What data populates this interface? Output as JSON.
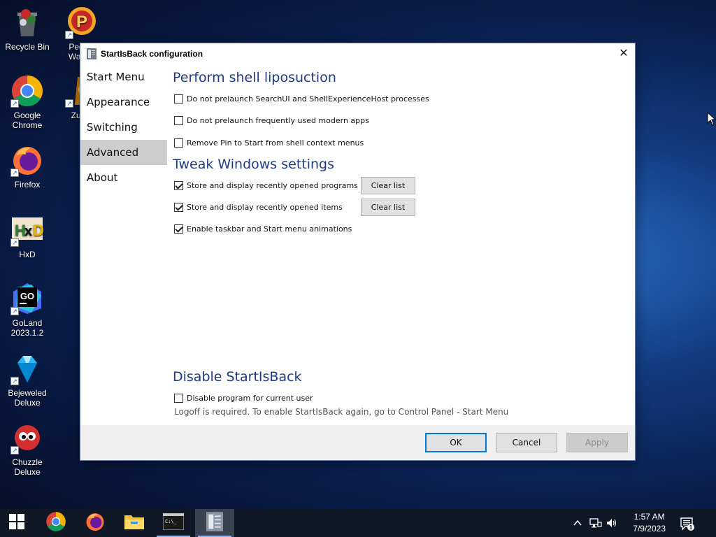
{
  "desktop": {
    "icons": [
      {
        "label": "Recycle Bin",
        "icon": "recycle-bin-icon"
      },
      {
        "label": "Peggle",
        "label2": "Warcra",
        "icon": "peggle-icon"
      },
      {
        "label": "Google Chrome",
        "icon": "chrome-icon"
      },
      {
        "label": "Zuma",
        "icon": "zuma-icon"
      },
      {
        "label": "Firefox",
        "icon": "firefox-icon"
      },
      {
        "label": "HxD",
        "icon": "hxd-icon"
      },
      {
        "label": "GoLand",
        "label2": "2023.1.2",
        "icon": "goland-icon"
      },
      {
        "label": "Bejeweled",
        "label2": "Deluxe",
        "icon": "bejeweled-icon"
      },
      {
        "label": "Chuzzle Deluxe",
        "icon": "chuzzle-icon"
      }
    ]
  },
  "dialog": {
    "title": "StartIsBack configuration",
    "close_glyph": "✕",
    "nav": [
      {
        "label": "Start Menu"
      },
      {
        "label": "Appearance"
      },
      {
        "label": "Switching"
      },
      {
        "label": "Advanced",
        "selected": true
      },
      {
        "label": "About"
      }
    ],
    "sections": {
      "liposuction": {
        "heading": "Perform shell liposuction",
        "options": [
          {
            "label": "Do not prelaunch SearchUI and ShellExperienceHost processes",
            "checked": false
          },
          {
            "label": "Do not prelaunch frequently used modern apps",
            "checked": false
          },
          {
            "label": "Remove Pin to Start from shell context menus",
            "checked": false
          }
        ]
      },
      "tweak": {
        "heading": "Tweak Windows settings",
        "options": [
          {
            "label": "Store and display recently opened programs",
            "checked": true,
            "button": "Clear list"
          },
          {
            "label": "Store and display recently opened items",
            "checked": true,
            "button": "Clear list"
          },
          {
            "label": "Enable taskbar and Start menu animations",
            "checked": true
          }
        ]
      },
      "disable": {
        "heading": "Disable StartIsBack",
        "options": [
          {
            "label": "Disable program for current user",
            "checked": false
          }
        ],
        "note": "Logoff is required. To enable StartIsBack again, go to Control Panel - Start Menu"
      }
    },
    "footer": {
      "ok": "OK",
      "cancel": "Cancel",
      "apply": "Apply"
    }
  },
  "taskbar": {
    "items": [
      {
        "icon": "windows-start-icon"
      },
      {
        "icon": "chrome-icon"
      },
      {
        "icon": "firefox-icon"
      },
      {
        "icon": "file-explorer-icon"
      },
      {
        "icon": "command-prompt-icon",
        "running": true
      },
      {
        "icon": "startisback-icon",
        "running": true,
        "active": true
      }
    ],
    "tray": {
      "chevron": "^",
      "time": "1:57 AM",
      "date": "7/9/2023",
      "notification_count": "1"
    }
  }
}
